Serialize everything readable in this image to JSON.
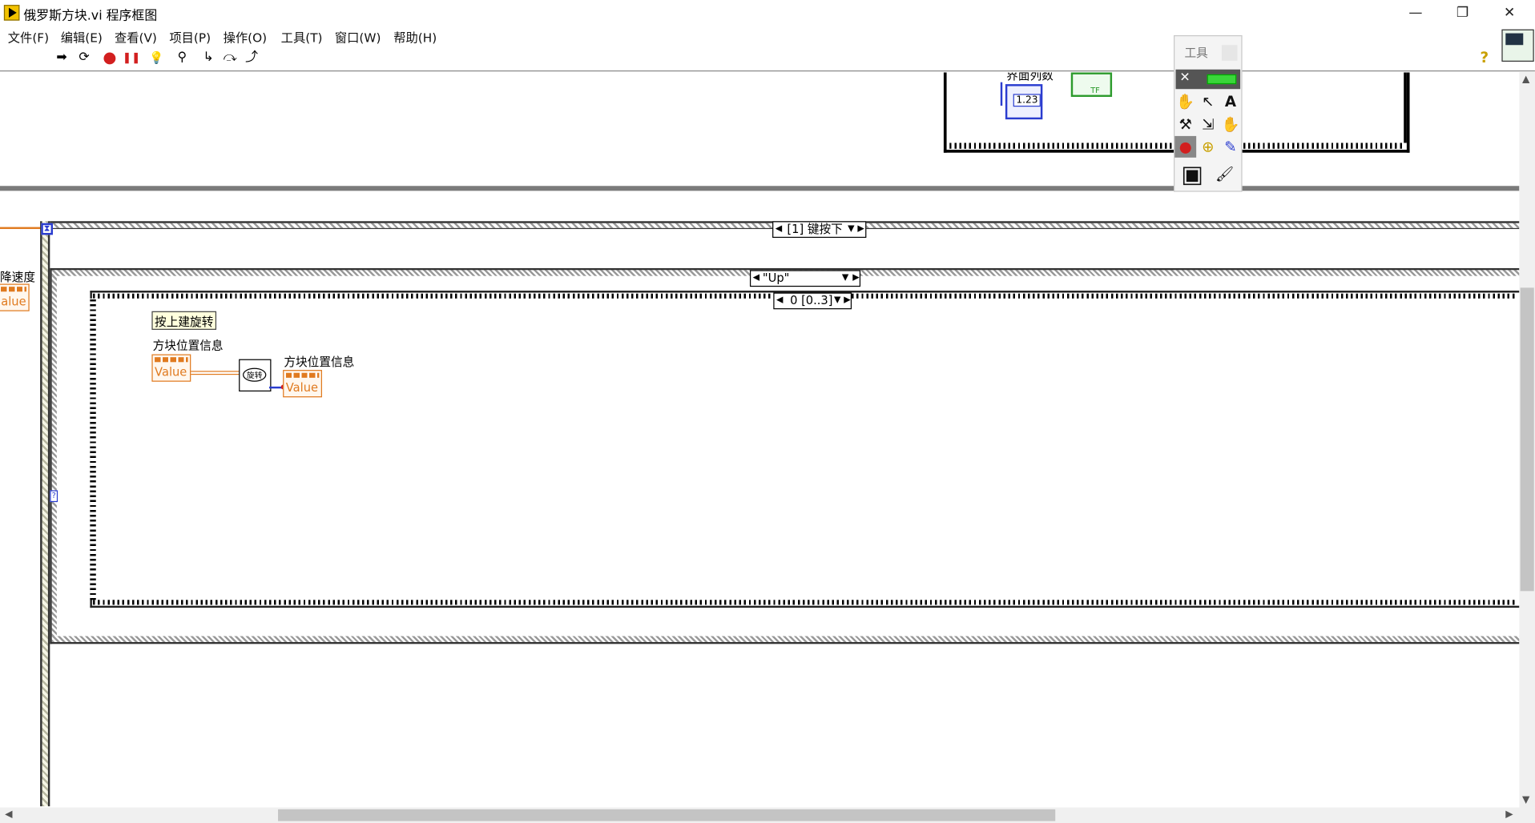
{
  "window": {
    "title": "俄罗斯方块.vi 程序框图",
    "minimize": "—",
    "maximize": "❐",
    "close": "✕"
  },
  "menu": [
    {
      "label": "文件(F)"
    },
    {
      "label": "编辑(E)"
    },
    {
      "label": "查看(V)"
    },
    {
      "label": "项目(P)"
    },
    {
      "label": "操作(O)"
    },
    {
      "label": "工具(T)"
    },
    {
      "label": "窗口(W)"
    },
    {
      "label": "帮助(H)"
    }
  ],
  "toolbar": {
    "run_icon": "➡",
    "run_continuous_icon": "⟳",
    "abort_icon": "●",
    "pause_icon": "❚❚",
    "highlight_icon": "💡",
    "retain_wire_icon": "⚲",
    "step_into_icon": "↳",
    "step_over_icon": "⤼",
    "step_out_icon": "⤴",
    "help_icon": "?"
  },
  "diagram": {
    "top_label_partial": "界面列数",
    "numeric_indicator": "1.23",
    "bool_indicator": "TF",
    "event_selector": "[1] 键按下",
    "case_selector": "\"Up\"",
    "sequence_selector": "0 [0..3]",
    "left_label": "降速度",
    "left_terminal": "alue",
    "comment": "按上建旋转",
    "input_label": "方块位置信息",
    "input_value": "Value",
    "subvi_label": "旋转",
    "output_label": "方块位置信息",
    "output_value": "Value",
    "iteration_terminal": "?"
  },
  "palette": {
    "title": "工具",
    "tools": [
      "✋",
      "↖",
      "A",
      "⚒",
      "⇲",
      "✋",
      "●",
      "⊕",
      "✎",
      "▣",
      "🖌"
    ]
  },
  "colors": {
    "orange_wire": "#e07a1f",
    "blue_wire": "#2a3ccf",
    "scroll_thumb": "#c4c4c4"
  }
}
